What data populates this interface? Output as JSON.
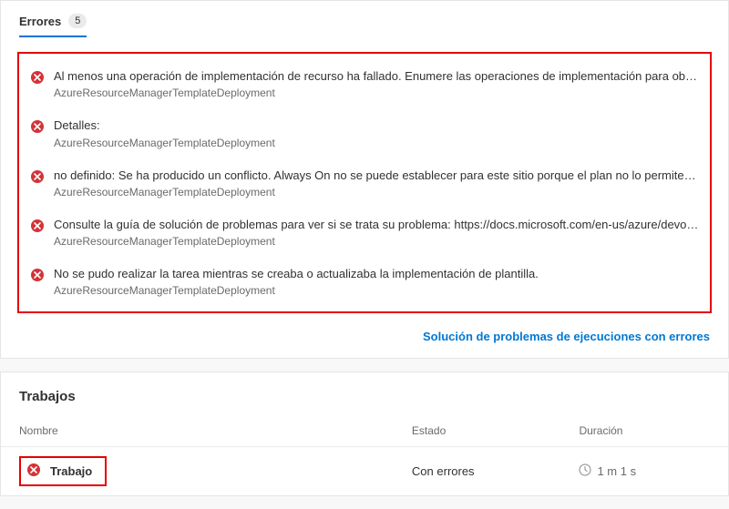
{
  "tab": {
    "label": "Errores",
    "count": "5"
  },
  "errors": [
    {
      "message": "Al menos una operación de implementación de recurso ha fallado. Enumere las operaciones de implementación para obtener detalles. ...",
      "source": "AzureResourceManagerTemplateDeployment"
    },
    {
      "message": "Detalles:",
      "source": "AzureResourceManagerTemplateDeployment"
    },
    {
      "message": "no definido: Se ha producido un conflicto. Always On no se puede establecer para este sitio porque el plan no lo permite. Para obtener ...",
      "source": "AzureResourceManagerTemplateDeployment"
    },
    {
      "message": "Consulte la guía de solución de problemas para ver si se trata su problema: https://docs.microsoft.com/en-us/azure/devops/pipelines/...",
      "source": "AzureResourceManagerTemplateDeployment"
    },
    {
      "message": "No se pudo realizar la tarea mientras se creaba o actualizaba la implementación de plantilla.",
      "source": "AzureResourceManagerTemplateDeployment"
    }
  ],
  "troubleshoot_link": "Solución de problemas de ejecuciones con errores",
  "jobs": {
    "heading": "Trabajos",
    "columns": {
      "name": "Nombre",
      "state": "Estado",
      "duration": "Duración"
    },
    "rows": [
      {
        "name": "Trabajo",
        "state": "Con errores",
        "duration": "1 m 1 s"
      }
    ]
  }
}
